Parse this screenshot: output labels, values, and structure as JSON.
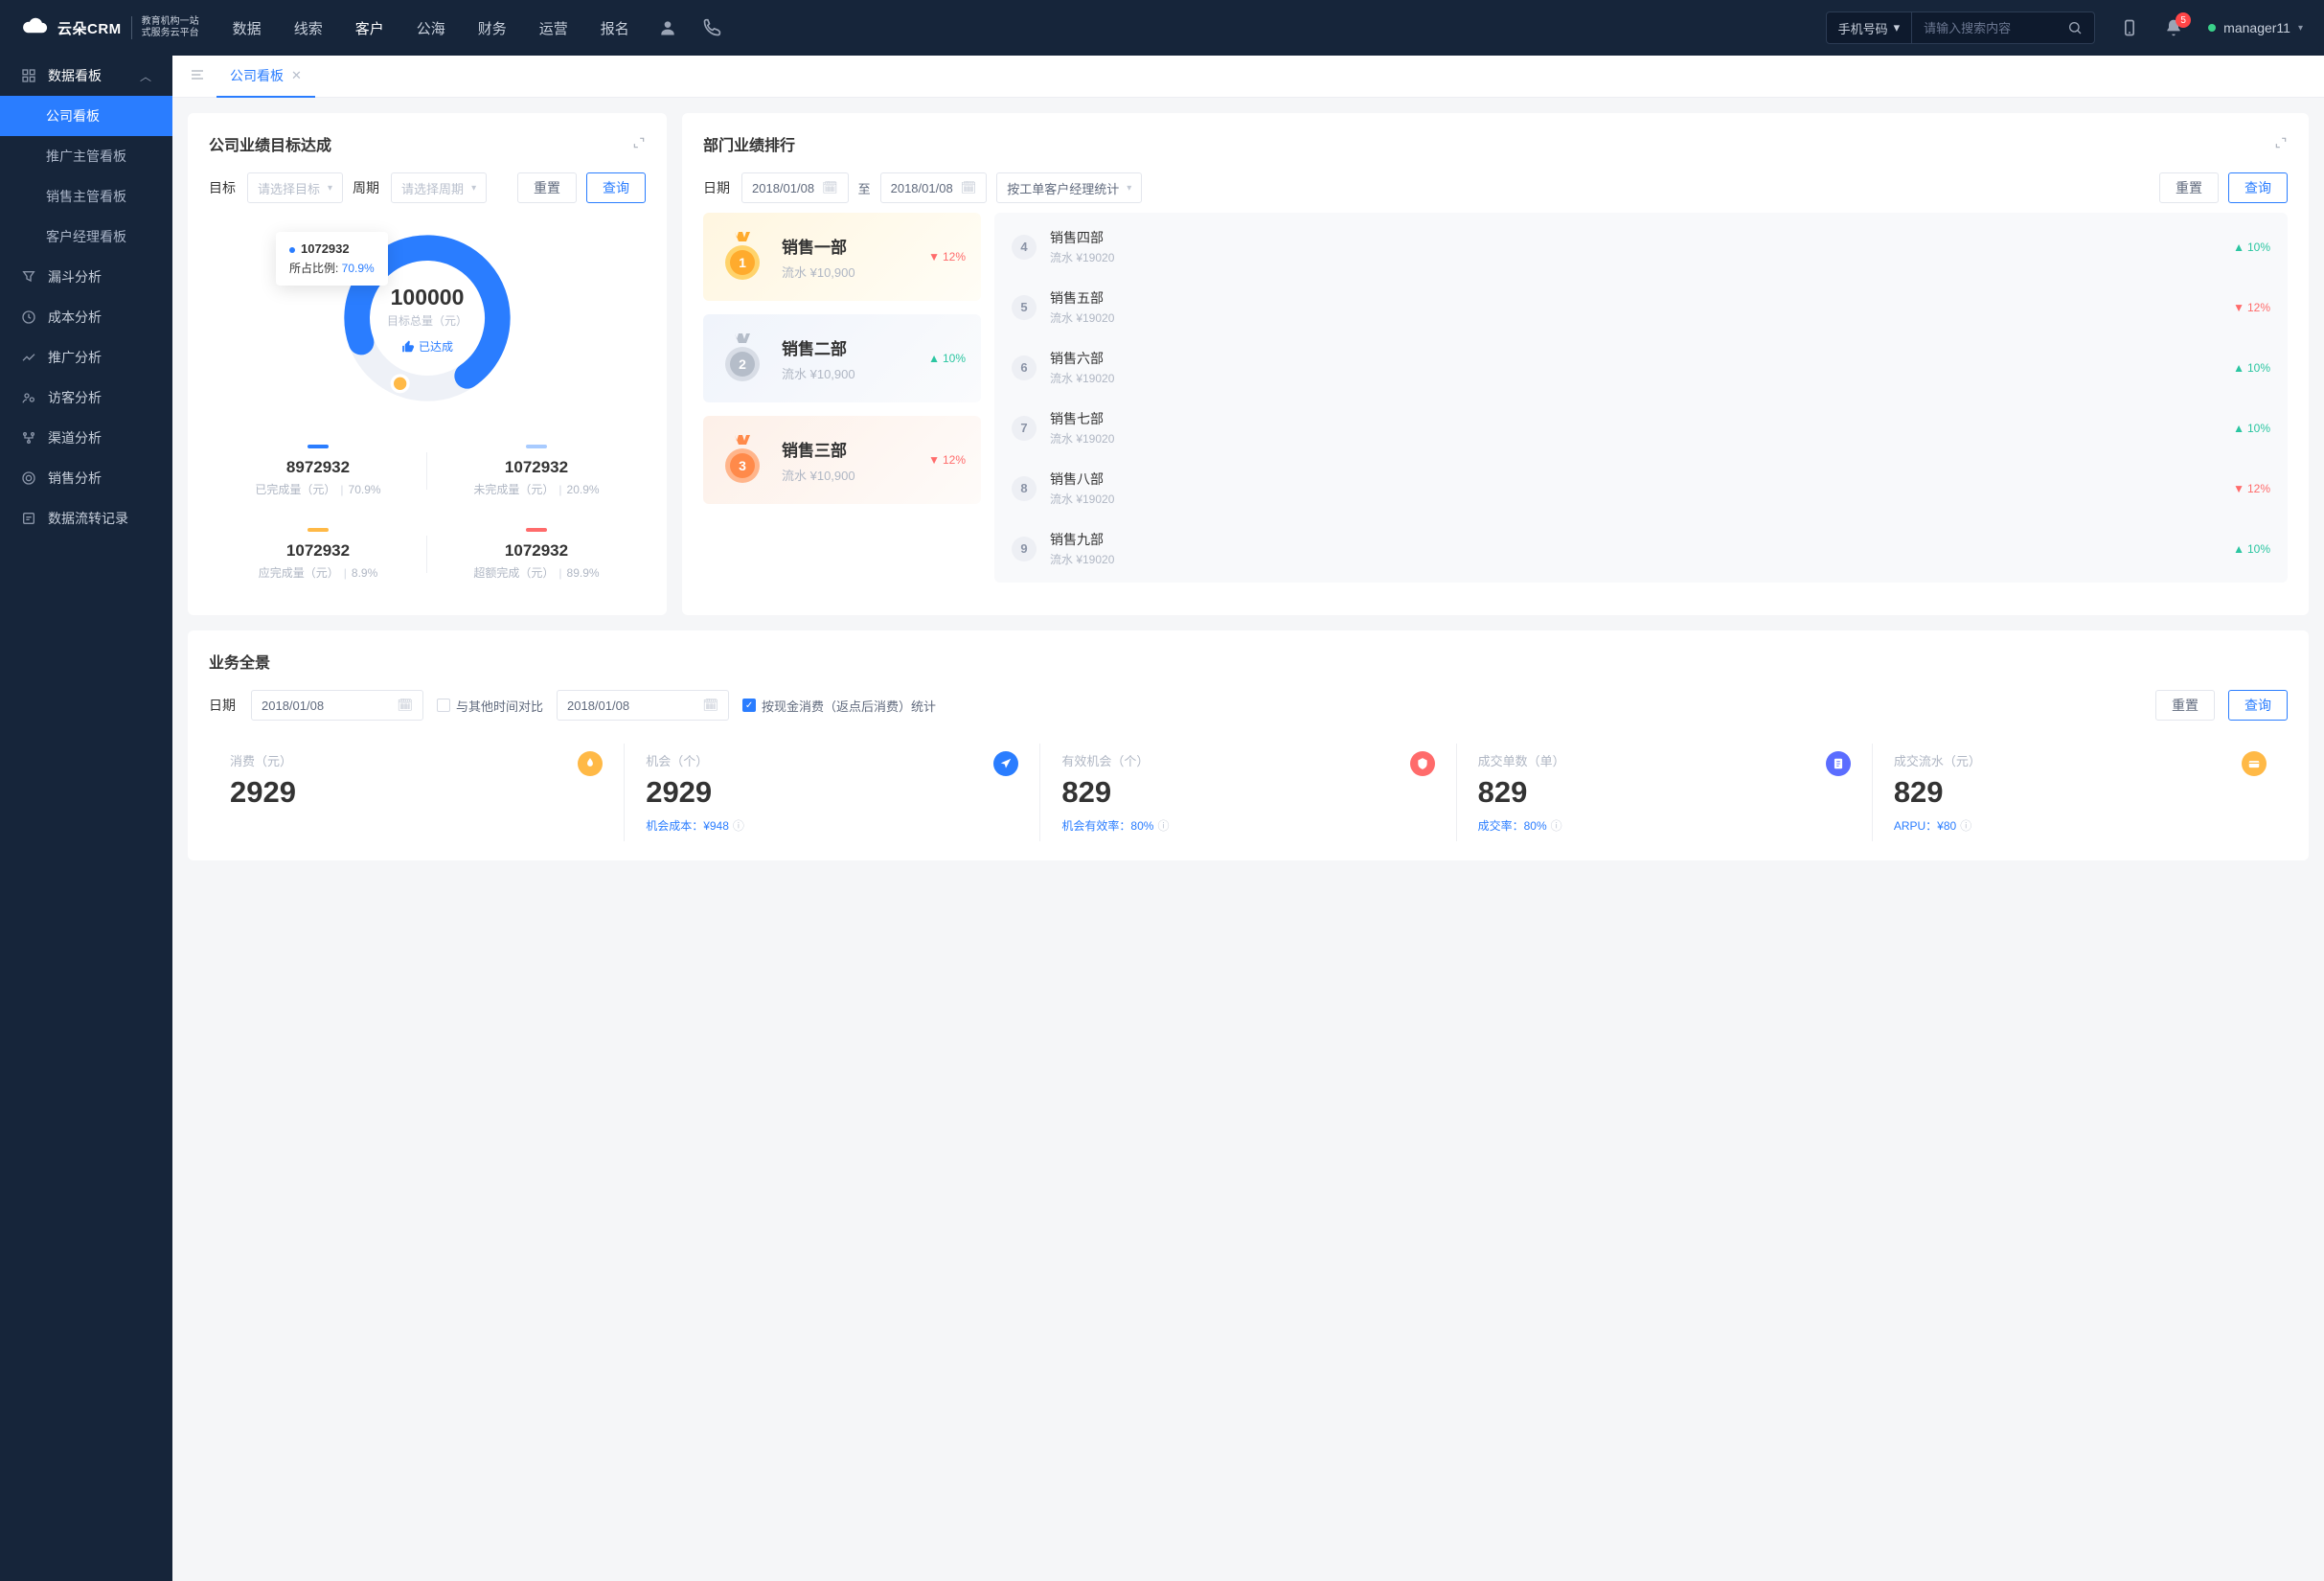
{
  "brand": {
    "crm": "云朵CRM",
    "sub1": "教育机构一站",
    "sub2": "式服务云平台"
  },
  "topnav": [
    "数据",
    "线索",
    "客户",
    "公海",
    "财务",
    "运营",
    "报名"
  ],
  "topnav_active_index": 2,
  "search": {
    "type": "手机号码",
    "placeholder": "请输入搜索内容"
  },
  "notification_count": "5",
  "username": "manager11",
  "sidebar": {
    "parent": "数据看板",
    "subs": [
      "公司看板",
      "推广主管看板",
      "销售主管看板",
      "客户经理看板"
    ],
    "active_sub_index": 0,
    "items": [
      "漏斗分析",
      "成本分析",
      "推广分析",
      "访客分析",
      "渠道分析",
      "销售分析",
      "数据流转记录"
    ]
  },
  "tab": {
    "label": "公司看板"
  },
  "target_card": {
    "title": "公司业绩目标达成",
    "target_label": "目标",
    "target_placeholder": "请选择目标",
    "period_label": "周期",
    "period_placeholder": "请选择周期",
    "reset": "重置",
    "query": "查询",
    "tooltip_value": "1072932",
    "tooltip_ratio_label": "所占比例: ",
    "tooltip_ratio": "70.9%",
    "total": "100000",
    "total_label": "目标总量（元）",
    "achieved": "已达成",
    "stats": [
      {
        "value": "8972932",
        "label": "已完成量（元）",
        "pct": "70.9%",
        "color": "#2a7dff"
      },
      {
        "value": "1072932",
        "label": "未完成量（元）",
        "pct": "20.9%",
        "color": "#a8cbff"
      },
      {
        "value": "1072932",
        "label": "应完成量（元）",
        "pct": "8.9%",
        "color": "#ffb946"
      },
      {
        "value": "1072932",
        "label": "超额完成（元）",
        "pct": "89.9%",
        "color": "#ff6b6b"
      }
    ]
  },
  "rank_card": {
    "title": "部门业绩排行",
    "date_label": "日期",
    "date_from": "2018/01/08",
    "date_sep": "至",
    "date_to": "2018/01/08",
    "group_placeholder": "按工单客户经理统计",
    "reset": "重置",
    "query": "查询",
    "top": [
      {
        "rank": "1",
        "name": "销售一部",
        "meta": "流水 ¥10,900",
        "trend": "down",
        "trend_val": "12%"
      },
      {
        "rank": "2",
        "name": "销售二部",
        "meta": "流水 ¥10,900",
        "trend": "up",
        "trend_val": "10%"
      },
      {
        "rank": "3",
        "name": "销售三部",
        "meta": "流水 ¥10,900",
        "trend": "down",
        "trend_val": "12%"
      }
    ],
    "rest": [
      {
        "rank": "4",
        "name": "销售四部",
        "meta": "流水 ¥19020",
        "trend": "up",
        "trend_val": "10%"
      },
      {
        "rank": "5",
        "name": "销售五部",
        "meta": "流水 ¥19020",
        "trend": "down",
        "trend_val": "12%"
      },
      {
        "rank": "6",
        "name": "销售六部",
        "meta": "流水 ¥19020",
        "trend": "up",
        "trend_val": "10%"
      },
      {
        "rank": "7",
        "name": "销售七部",
        "meta": "流水 ¥19020",
        "trend": "up",
        "trend_val": "10%"
      },
      {
        "rank": "8",
        "name": "销售八部",
        "meta": "流水 ¥19020",
        "trend": "down",
        "trend_val": "12%"
      },
      {
        "rank": "9",
        "name": "销售九部",
        "meta": "流水 ¥19020",
        "trend": "up",
        "trend_val": "10%"
      }
    ]
  },
  "pano_card": {
    "title": "业务全景",
    "date_label": "日期",
    "date1": "2018/01/08",
    "compare_label": "与其他时间对比",
    "date2": "2018/01/08",
    "cash_label": "按现金消费（返点后消费）统计",
    "reset": "重置",
    "query": "查询",
    "tiles": [
      {
        "label": "消费（元）",
        "value": "2929",
        "sub": "",
        "color": "#ffb946"
      },
      {
        "label": "机会（个）",
        "value": "2929",
        "sub_k": "机会成本：",
        "sub_v": "¥948",
        "color": "#2a7dff"
      },
      {
        "label": "有效机会（个）",
        "value": "829",
        "sub_k": "机会有效率：",
        "sub_v": "80%",
        "color": "#ff6b6b"
      },
      {
        "label": "成交单数（单）",
        "value": "829",
        "sub_k": "成交率：",
        "sub_v": "80%",
        "color": "#5b6dff"
      },
      {
        "label": "成交流水（元）",
        "value": "829",
        "sub_k": "ARPU：",
        "sub_v": "¥80",
        "color": "#ffb946"
      }
    ]
  },
  "chart_data": {
    "type": "pie",
    "title": "公司业绩目标达成",
    "total": 100000,
    "total_label": "目标总量（元）",
    "series": [
      {
        "name": "已完成量（元）",
        "value": 8972932,
        "pct": 70.9,
        "color": "#2a7dff"
      },
      {
        "name": "未完成量（元）",
        "value": 1072932,
        "pct": 20.9,
        "color": "#a8cbff"
      },
      {
        "name": "应完成量（元）",
        "value": 1072932,
        "pct": 8.9,
        "color": "#ffb946"
      },
      {
        "name": "超额完成（元）",
        "value": 1072932,
        "pct": 89.9,
        "color": "#ff6b6b"
      }
    ]
  }
}
